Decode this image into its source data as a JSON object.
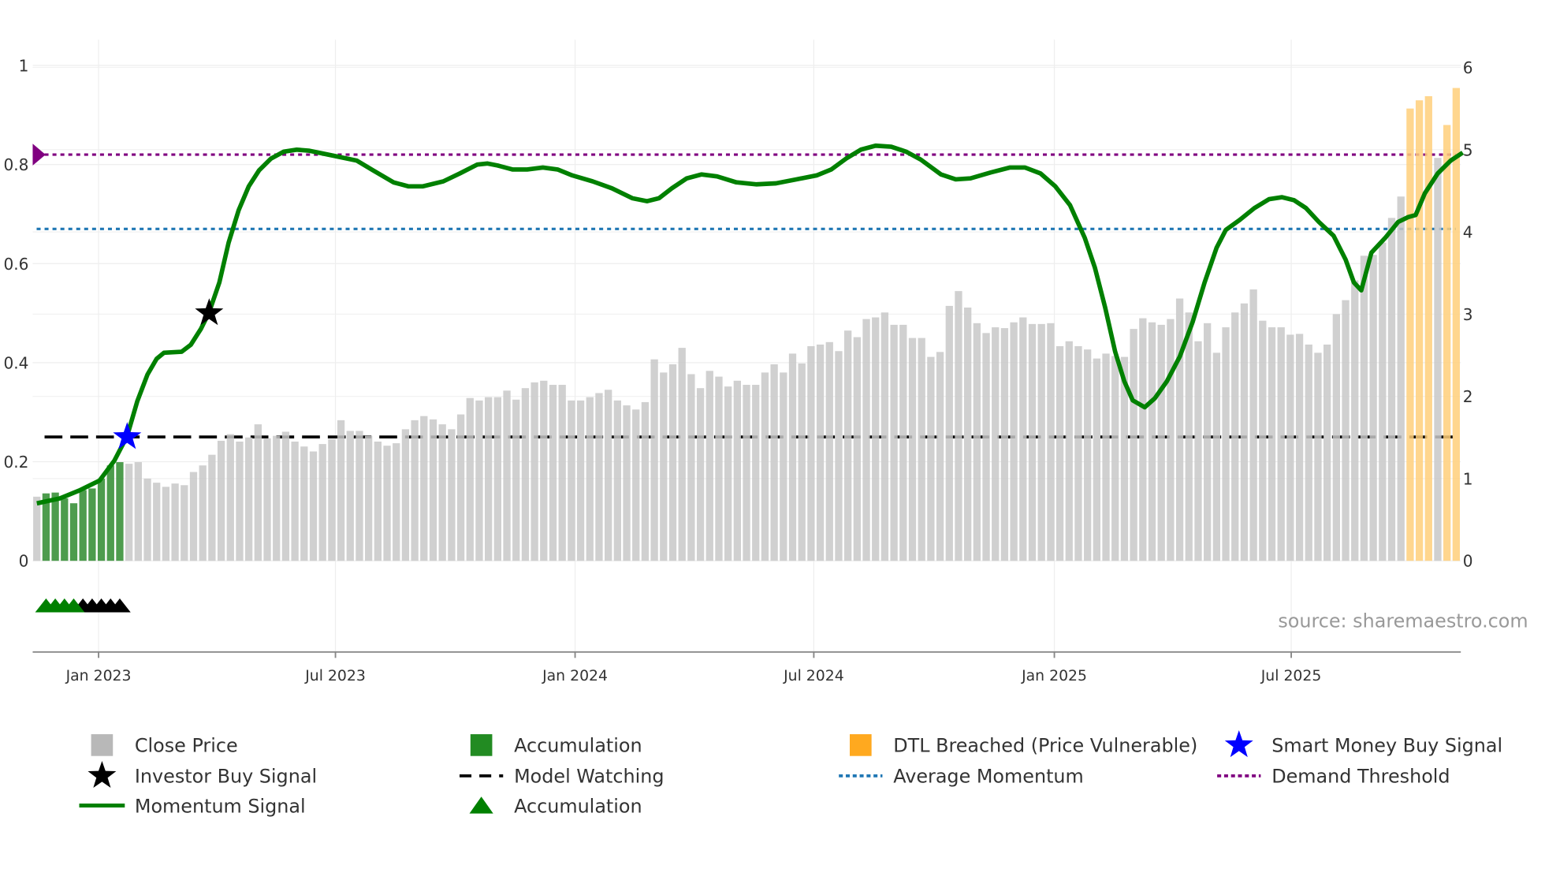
{
  "chart_data": {
    "type": "bar",
    "title": "",
    "source": "source: sharemaestro.com",
    "x_range_index": [
      -0.45,
      154.5
    ],
    "left_axis": {
      "ylim": [
        -0.184,
        1.0
      ],
      "ticks": [
        0,
        0.2,
        0.4,
        0.6,
        0.8,
        1
      ],
      "tick_labels": [
        "0",
        "0.2",
        "0.4",
        "0.6",
        "0.8",
        "1"
      ]
    },
    "right_axis": {
      "ylim": [
        0,
        6
      ],
      "ticks": [
        0,
        1,
        2,
        3,
        4,
        5,
        6
      ],
      "tick_labels": [
        "0",
        "1",
        "2",
        "3",
        "4",
        "5",
        "6"
      ]
    },
    "x_ticks": [
      {
        "label": "Jan 2023",
        "index": 6.7
      },
      {
        "label": "Jul 2023",
        "index": 32.4
      },
      {
        "label": "Jan 2024",
        "index": 58.4
      },
      {
        "label": "Jul 2024",
        "index": 84.3
      },
      {
        "label": "Jan 2025",
        "index": 110.4
      },
      {
        "label": "Jul 2025",
        "index": 136.1
      }
    ],
    "close_price": [
      0.78,
      0.82,
      0.83,
      0.76,
      0.7,
      0.86,
      0.88,
      1.0,
      1.16,
      1.2,
      1.18,
      1.2,
      1.0,
      0.95,
      0.9,
      0.94,
      0.92,
      1.08,
      1.16,
      1.29,
      1.46,
      1.54,
      1.45,
      1.5,
      1.66,
      1.49,
      1.52,
      1.57,
      1.45,
      1.39,
      1.33,
      1.42,
      1.48,
      1.71,
      1.58,
      1.58,
      1.52,
      1.45,
      1.4,
      1.43,
      1.6,
      1.71,
      1.76,
      1.72,
      1.66,
      1.6,
      1.78,
      1.98,
      1.95,
      1.99,
      1.99,
      2.07,
      1.96,
      2.1,
      2.17,
      2.19,
      2.14,
      2.14,
      1.95,
      1.95,
      1.99,
      2.04,
      2.08,
      1.95,
      1.89,
      1.84,
      1.93,
      2.45,
      2.29,
      2.39,
      2.59,
      2.27,
      2.1,
      2.31,
      2.24,
      2.12,
      2.19,
      2.14,
      2.14,
      2.29,
      2.39,
      2.29,
      2.52,
      2.4,
      2.61,
      2.63,
      2.66,
      2.55,
      2.8,
      2.72,
      2.94,
      2.96,
      3.02,
      2.87,
      2.87,
      2.71,
      2.71,
      2.48,
      2.54,
      3.1,
      3.28,
      3.08,
      2.89,
      2.77,
      2.84,
      2.83,
      2.9,
      2.96,
      2.88,
      2.88,
      2.89,
      2.61,
      2.67,
      2.61,
      2.57,
      2.46,
      2.52,
      2.49,
      2.48,
      2.82,
      2.95,
      2.9,
      2.87,
      2.94,
      3.19,
      3.02,
      2.67,
      2.89,
      2.53,
      2.84,
      3.02,
      3.13,
      3.3,
      2.92,
      2.84,
      2.84,
      2.75,
      2.76,
      2.63,
      2.53,
      2.63,
      3.0,
      3.17,
      3.41,
      3.71,
      3.72,
      3.87,
      4.17,
      4.43,
      5.5,
      5.6,
      5.65,
      4.9,
      5.3,
      5.75
    ],
    "accumulation_bars": [
      1,
      2,
      3,
      4,
      5,
      6,
      7,
      8,
      9
    ],
    "dtl_breached_bars": [
      149,
      150,
      151,
      153,
      154
    ],
    "momentum": [
      [
        0,
        0.116
      ],
      [
        2.5,
        0.126
      ],
      [
        4.6,
        0.142
      ],
      [
        6.8,
        0.162
      ],
      [
        8.4,
        0.202
      ],
      [
        9.8,
        0.252
      ],
      [
        10.9,
        0.322
      ],
      [
        12,
        0.376
      ],
      [
        13,
        0.408
      ],
      [
        13.8,
        0.42
      ],
      [
        15.7,
        0.422
      ],
      [
        16.7,
        0.436
      ],
      [
        17.8,
        0.468
      ],
      [
        18.7,
        0.502
      ],
      [
        19.8,
        0.562
      ],
      [
        20.8,
        0.642
      ],
      [
        21.9,
        0.708
      ],
      [
        23,
        0.756
      ],
      [
        24.1,
        0.788
      ],
      [
        25.4,
        0.812
      ],
      [
        26.8,
        0.826
      ],
      [
        28.2,
        0.83
      ],
      [
        29.5,
        0.828
      ],
      [
        31.6,
        0.82
      ],
      [
        34.7,
        0.808
      ],
      [
        36.5,
        0.788
      ],
      [
        38.7,
        0.764
      ],
      [
        40.3,
        0.756
      ],
      [
        41.9,
        0.756
      ],
      [
        44.1,
        0.766
      ],
      [
        45.9,
        0.782
      ],
      [
        47.8,
        0.8
      ],
      [
        48.9,
        0.802
      ],
      [
        50,
        0.798
      ],
      [
        51.6,
        0.79
      ],
      [
        53.2,
        0.79
      ],
      [
        54.9,
        0.794
      ],
      [
        56.5,
        0.79
      ],
      [
        58.1,
        0.778
      ],
      [
        60.3,
        0.766
      ],
      [
        62.4,
        0.752
      ],
      [
        64.6,
        0.732
      ],
      [
        66.2,
        0.726
      ],
      [
        67.5,
        0.732
      ],
      [
        68.9,
        0.752
      ],
      [
        70.5,
        0.772
      ],
      [
        72.1,
        0.78
      ],
      [
        73.8,
        0.776
      ],
      [
        75.9,
        0.764
      ],
      [
        78.1,
        0.76
      ],
      [
        80.2,
        0.762
      ],
      [
        82.4,
        0.77
      ],
      [
        84.6,
        0.778
      ],
      [
        86.2,
        0.79
      ],
      [
        87.8,
        0.812
      ],
      [
        89.4,
        0.83
      ],
      [
        91,
        0.838
      ],
      [
        92.7,
        0.836
      ],
      [
        94.3,
        0.826
      ],
      [
        95.9,
        0.81
      ],
      [
        98.1,
        0.78
      ],
      [
        99.7,
        0.77
      ],
      [
        101.3,
        0.772
      ],
      [
        103.5,
        0.784
      ],
      [
        105.6,
        0.794
      ],
      [
        107.2,
        0.794
      ],
      [
        108.9,
        0.782
      ],
      [
        110.5,
        0.756
      ],
      [
        112.1,
        0.718
      ],
      [
        113.7,
        0.652
      ],
      [
        114.8,
        0.592
      ],
      [
        115.9,
        0.512
      ],
      [
        117,
        0.422
      ],
      [
        118,
        0.362
      ],
      [
        118.9,
        0.324
      ],
      [
        120.2,
        0.31
      ],
      [
        121.3,
        0.328
      ],
      [
        122.6,
        0.362
      ],
      [
        124,
        0.412
      ],
      [
        125.4,
        0.482
      ],
      [
        126.7,
        0.562
      ],
      [
        128,
        0.632
      ],
      [
        129,
        0.668
      ],
      [
        130.5,
        0.688
      ],
      [
        132.1,
        0.712
      ],
      [
        133.7,
        0.73
      ],
      [
        135.1,
        0.734
      ],
      [
        136.4,
        0.728
      ],
      [
        137.7,
        0.712
      ],
      [
        139.1,
        0.684
      ],
      [
        140.7,
        0.656
      ],
      [
        142,
        0.608
      ],
      [
        142.9,
        0.562
      ],
      [
        143.7,
        0.546
      ],
      [
        144.8,
        0.622
      ],
      [
        146.3,
        0.652
      ],
      [
        147.7,
        0.684
      ],
      [
        148.8,
        0.694
      ],
      [
        149.6,
        0.698
      ],
      [
        150.6,
        0.742
      ],
      [
        152,
        0.782
      ],
      [
        153.4,
        0.808
      ],
      [
        154.7,
        0.824
      ]
    ],
    "model_watching_level": 0.25,
    "average_momentum_level": 0.67,
    "demand_threshold_level": 0.82,
    "smart_money_buy_signal": {
      "index": 9.8,
      "value": 0.25
    },
    "investor_buy_signal": {
      "index": 18.7,
      "value": 0.5
    },
    "accumulation_triangles": {
      "green": [
        1,
        2,
        3,
        4
      ],
      "black": [
        5,
        6,
        7,
        8,
        9
      ],
      "value": -0.09
    },
    "legend": [
      {
        "label": "Close Price",
        "marker": "square",
        "color": "#b8b8b8"
      },
      {
        "label": "Accumulation",
        "marker": "square",
        "color": "#228b22"
      },
      {
        "label": "DTL Breached (Price Vulnerable)",
        "marker": "square",
        "color": "#ffa91f"
      },
      {
        "label": "Smart Money Buy Signal",
        "marker": "star",
        "color": "#0000ff"
      },
      {
        "label": "Investor Buy Signal",
        "marker": "star",
        "color": "#000000"
      },
      {
        "label": "Model Watching",
        "marker": "dash",
        "color": "#000000"
      },
      {
        "label": "Average Momentum",
        "marker": "dot",
        "color": "#1f77b4"
      },
      {
        "label": "Demand Threshold",
        "marker": "dot",
        "color": "#800080"
      },
      {
        "label": "Momentum Signal",
        "marker": "line",
        "color": "#008000"
      },
      {
        "label": "Accumulation",
        "marker": "triangle",
        "color": "#008000"
      }
    ],
    "colors": {
      "price": "#c8c8c8",
      "accumulation": "#2e8b2e",
      "dtl": "#ffcf7a",
      "momentum": "#008000",
      "avg": "#1f77b4",
      "demand": "#800080"
    }
  }
}
